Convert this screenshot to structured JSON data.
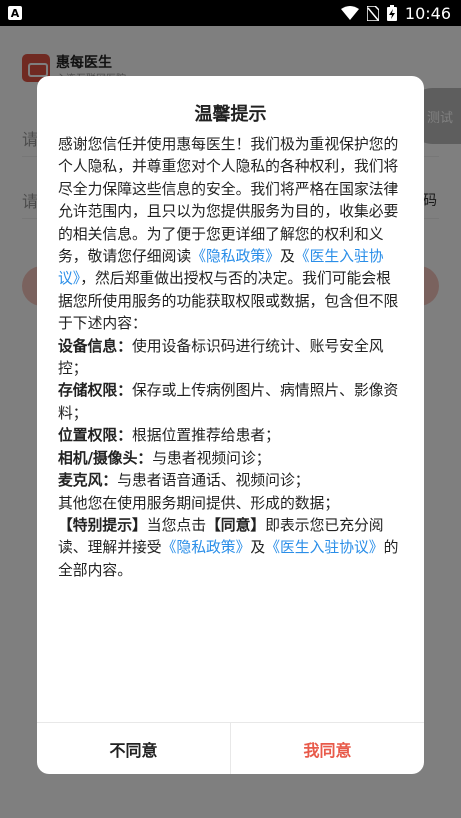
{
  "status_bar": {
    "time": "10:46",
    "app_indicator": "A",
    "icons": [
      "wifi-icon",
      "no-sim-icon",
      "battery-charging-icon"
    ]
  },
  "background": {
    "app_name": "惠每医生",
    "app_subtitle": "心连互联网医院",
    "test_label": "测试",
    "input1_placeholder": "请",
    "input2_placeholder": "请",
    "code_label": "码",
    "accent_color": "#e05545"
  },
  "dialog": {
    "title": "温馨提示",
    "intro_1": "感谢您信任并使用惠每医生！我们极为重视保护您的个人隐私，并尊重您对个人隐私的各种权利，我们将尽全力保障这些信息的安全。我们将严格在国家法律允许范围内，且只以为您提供服务为目的，收集必要的相关信息。为了便于您更详细了解您的权利和义务，敬请您仔细阅读",
    "link_privacy": "《隐私政策》",
    "and": "及",
    "link_agreement": "《医生入驻协议》",
    "intro_2": "，然后郑重做出授权与否的决定。我们可能会根据您所使用服务的功能获取权限或数据，包含但不限于下述内容：",
    "items": [
      {
        "label": "设备信息：",
        "text": "使用设备标识码进行统计、账号安全风控；"
      },
      {
        "label": "存储权限：",
        "text": "保存或上传病例图片、病情照片、影像资料；"
      },
      {
        "label": "位置权限：",
        "text": "根据位置推荐给患者；"
      },
      {
        "label": "相机/摄像头：",
        "text": "与患者视频问诊；"
      },
      {
        "label": "麦克风：",
        "text": "与患者语音通话、视频问诊；"
      }
    ],
    "other_data": "其他您在使用服务期间提供、形成的数据；",
    "special_label": "【特别提示】",
    "special_text_1": "当您点击",
    "agree_bracket": "【同意】",
    "special_text_2": "即表示您已充分阅读、理解并接受",
    "special_link_privacy": "《隐私政策》",
    "special_and": "及",
    "special_link_agreement": "《医生入驻协议》",
    "special_text_3": "的全部内容。",
    "disagree_label": "不同意",
    "agree_label": "我同意",
    "link_color": "#2a8ee8",
    "agree_color": "#e85a4a"
  }
}
